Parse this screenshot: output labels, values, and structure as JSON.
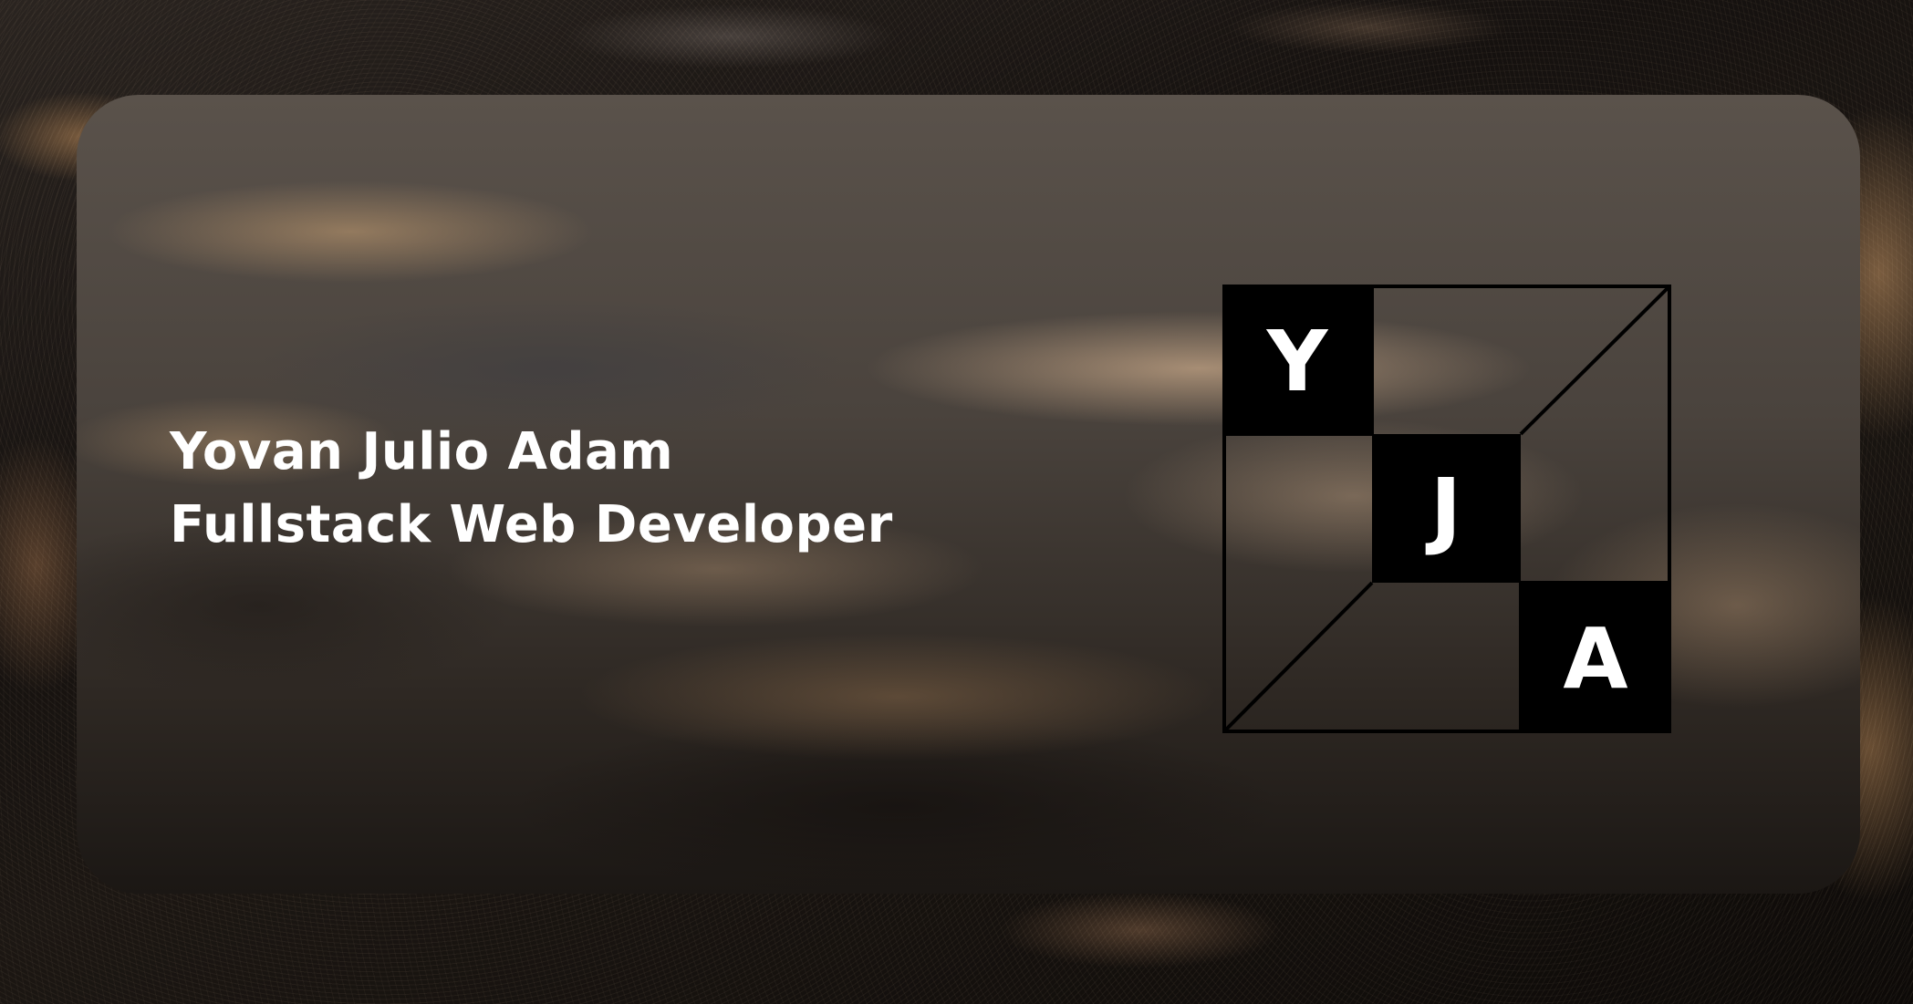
{
  "card": {
    "name_line": "Yovan Julio Adam",
    "title_line": "Fullstack Web Developer"
  },
  "logo": {
    "letter_1": "Y",
    "letter_2": "J",
    "letter_3": "A"
  },
  "colors": {
    "text": "#ffffff",
    "logo_block": "#000000"
  }
}
